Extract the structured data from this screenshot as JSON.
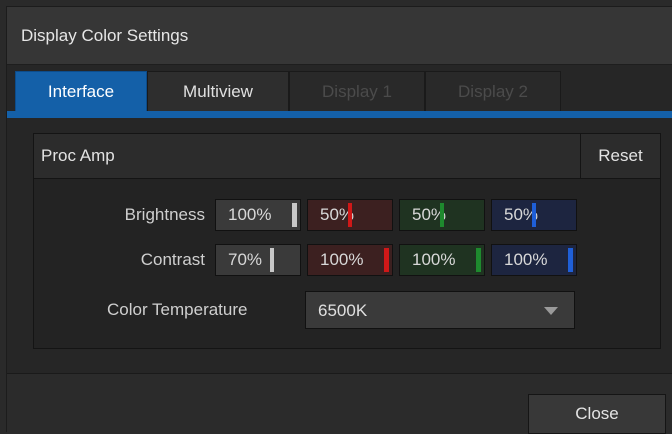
{
  "window": {
    "title": "Display Color Settings"
  },
  "tabs": [
    {
      "label": "Interface"
    },
    {
      "label": "Multiview"
    },
    {
      "label": "Display 1"
    },
    {
      "label": "Display 2"
    }
  ],
  "proc_amp": {
    "title": "Proc Amp",
    "reset_label": "Reset",
    "brightness": {
      "label": "Brightness",
      "master": "100%",
      "red": "50%",
      "green": "50%",
      "blue": "50%"
    },
    "contrast": {
      "label": "Contrast",
      "master": "70%",
      "red": "100%",
      "green": "100%",
      "blue": "100%"
    },
    "color_temperature": {
      "label": "Color Temperature",
      "value": "6500K"
    }
  },
  "footer": {
    "close_label": "Close"
  },
  "colors": {
    "accent": "#1460a8",
    "marker_white": "#c8c8c8",
    "marker_red": "#d01818",
    "marker_green": "#1e8a2e",
    "marker_blue": "#1f5fd8"
  }
}
